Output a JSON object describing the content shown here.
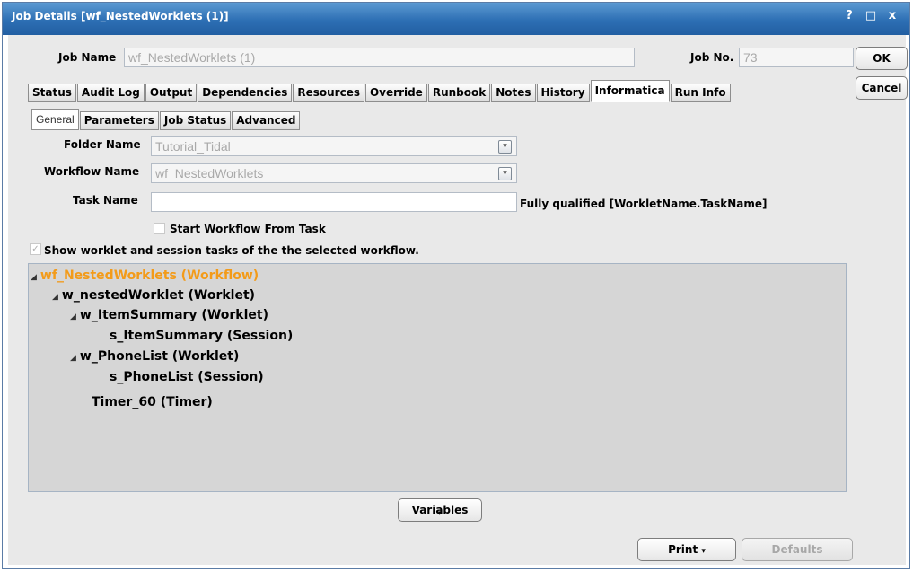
{
  "window": {
    "title": "Job Details [wf_NestedWorklets (1)]",
    "controls": {
      "help": "?",
      "maximize": "□",
      "close": "x"
    }
  },
  "header": {
    "job_name_label": "Job Name",
    "job_name_value": "wf_NestedWorklets (1)",
    "job_no_label": "Job No.",
    "job_no_value": "73",
    "ok_label": "OK",
    "cancel_label": "Cancel"
  },
  "tabs": [
    "Status",
    "Audit Log",
    "Output",
    "Dependencies",
    "Resources",
    "Override",
    "Runbook",
    "Notes",
    "History",
    "Informatica",
    "Run Info"
  ],
  "active_tab": "Informatica",
  "subtabs": [
    "General",
    "Parameters",
    "Job Status",
    "Advanced"
  ],
  "active_subtab": "General",
  "form": {
    "folder_label": "Folder Name",
    "folder_value": "Tutorial_Tidal",
    "workflow_label": "Workflow Name",
    "workflow_value": "wf_NestedWorklets",
    "task_label": "Task Name",
    "task_value": "",
    "task_hint": "Fully qualified [WorkletName.TaskName]",
    "start_from_task_label": "Start Workflow From Task",
    "start_from_task_checked": false,
    "show_tasks_label": "Show worklet and session tasks of the the selected workflow.",
    "show_tasks_checked": true
  },
  "tree": [
    {
      "label": "wf_NestedWorklets (Workflow)",
      "expanded": true
    },
    {
      "label": "w_nestedWorklet (Worklet)",
      "expanded": true
    },
    {
      "label": "w_ItemSummary (Worklet)",
      "expanded": true
    },
    {
      "label": "s_ItemSummary (Session)"
    },
    {
      "label": "w_PhoneList (Worklet)",
      "expanded": true
    },
    {
      "label": "s_PhoneList (Session)"
    },
    {
      "label": "Timer_60 (Timer)"
    }
  ],
  "footer": {
    "variables_label": "Variables",
    "print_label": "Print",
    "defaults_label": "Defaults"
  },
  "colors": {
    "titlebar": "#2d6fb4",
    "root_node": "#f39b19",
    "tree_background": "#d6d6d6",
    "client_background": "#e9e9e9"
  }
}
